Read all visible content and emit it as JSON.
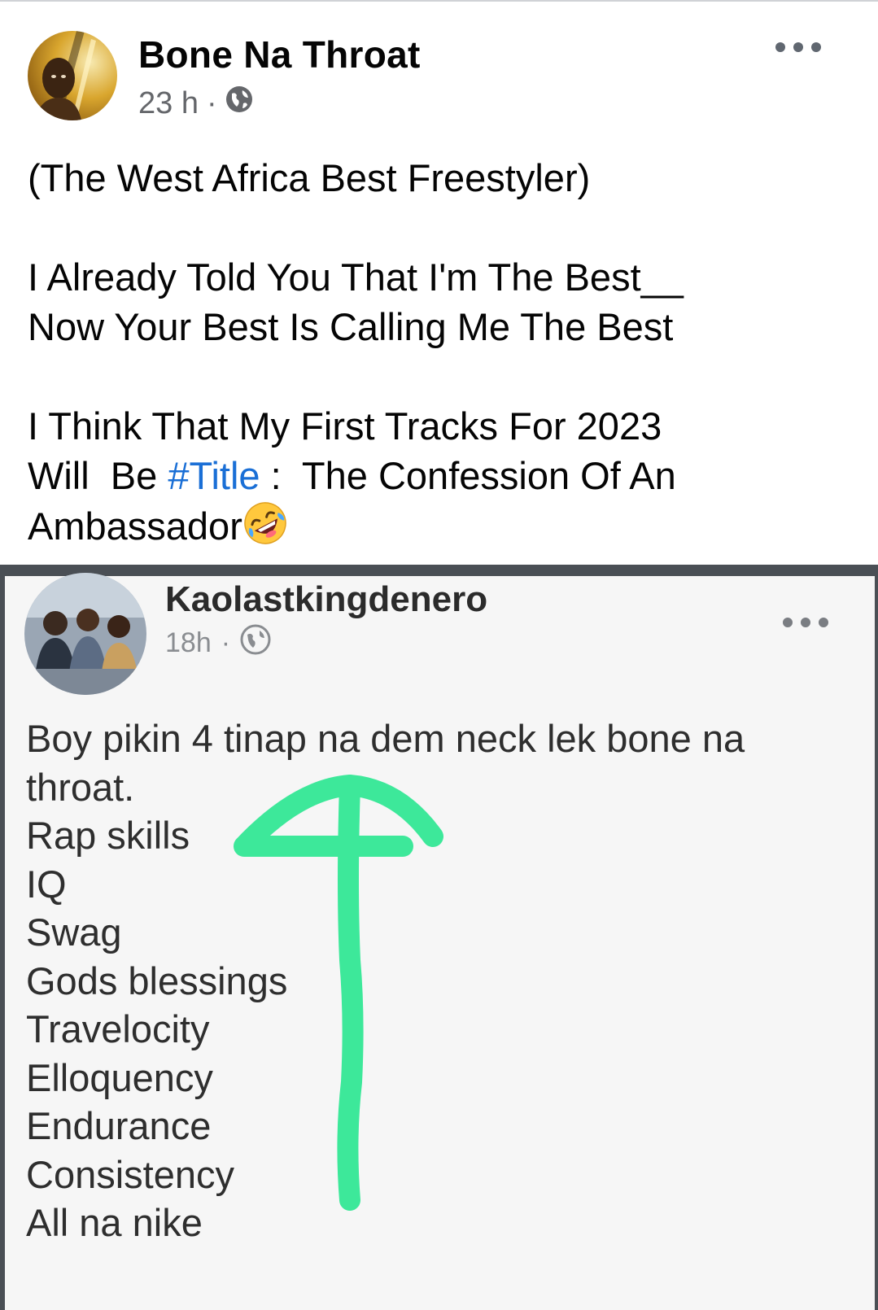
{
  "post": {
    "author": "Bone Na Throat",
    "time": "23 h",
    "separator": "·",
    "privacy_icon": "globe-icon",
    "more_icon": "more-options-icon",
    "lines": {
      "line1": "(The  West   Africa    Best    Freestyler)",
      "line2": "I Already Told You That I'm The Best__",
      "line3": "Now Your Best Is Calling Me The Best",
      "line4": "I Think That  My First  Tracks For 2023",
      "line5_before": "Will  Be ",
      "hashtag": "#Title",
      "line5_after": " :  The Confession Of An",
      "line6": "Ambassador"
    },
    "emoji": "rolling-on-floor-laughing-emoji"
  },
  "screenshot": {
    "author": "Kaolastkingdenero",
    "time": "18h",
    "separator": "·",
    "privacy_icon": "globe-icon",
    "lines": [
      "Boy pikin 4 tinap na dem neck lek bone na",
      "throat.",
      "Rap skills",
      "IQ",
      "Swag",
      "Gods blessings",
      "Travelocity",
      "Elloquency",
      "Endurance",
      "Consistency",
      "All na nike"
    ],
    "arrow_color": "#3de89a"
  },
  "colors": {
    "hashtag": "#1a6fd6",
    "meta_gray": "#65676b"
  }
}
